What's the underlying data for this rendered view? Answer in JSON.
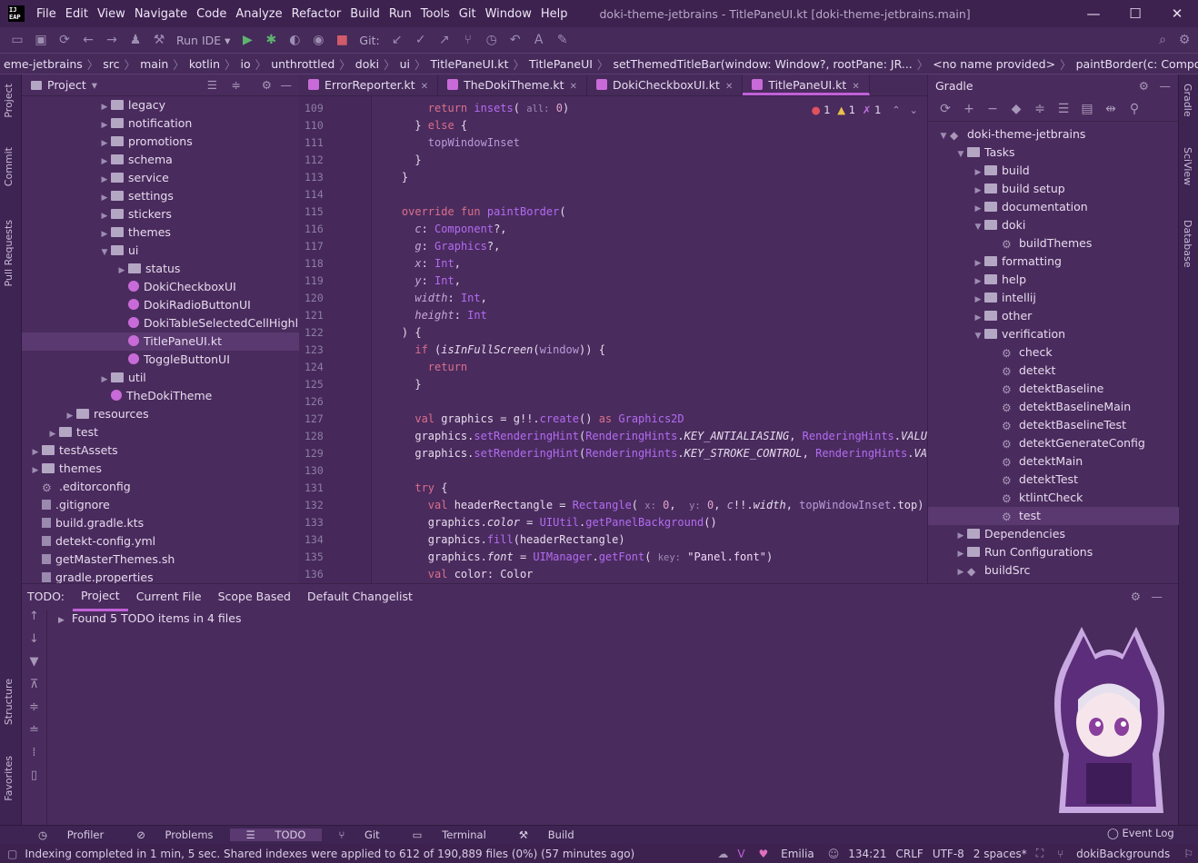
{
  "window": {
    "title": "doki-theme-jetbrains - TitlePaneUI.kt [doki-theme-jetbrains.main]",
    "logo": "IJ\nEAP",
    "minimize": "—",
    "maximize": "☐",
    "close": "✕"
  },
  "menu": [
    "File",
    "Edit",
    "View",
    "Navigate",
    "Code",
    "Analyze",
    "Refactor",
    "Build",
    "Run",
    "Tools",
    "Git",
    "Window",
    "Help"
  ],
  "toolbar": {
    "run_config": "Run IDE",
    "git_label": "Git:"
  },
  "breadcrumbs": [
    "eme-jetbrains",
    "src",
    "main",
    "kotlin",
    "io",
    "unthrottled",
    "doki",
    "ui",
    "TitlePaneUI.kt",
    "TitlePaneUI",
    "setThemedTitleBar(window: Window?, rootPane: JR...",
    "<no name provided>",
    "paintBorder(c: Component?, g: Graphics?, x: Int..."
  ],
  "left_strip": [
    "Project",
    "Commit",
    "Pull Requests",
    "Structure",
    "Favorites"
  ],
  "right_strip": [
    "Gradle",
    "SciView",
    "Database"
  ],
  "project_panel": {
    "title": "Project",
    "items": [
      {
        "label": "legacy",
        "depth": 4,
        "type": "folder",
        "arrow": "▶"
      },
      {
        "label": "notification",
        "depth": 4,
        "type": "folder",
        "arrow": "▶"
      },
      {
        "label": "promotions",
        "depth": 4,
        "type": "folder",
        "arrow": "▶"
      },
      {
        "label": "schema",
        "depth": 4,
        "type": "folder",
        "arrow": "▶"
      },
      {
        "label": "service",
        "depth": 4,
        "type": "folder",
        "arrow": "▶"
      },
      {
        "label": "settings",
        "depth": 4,
        "type": "folder",
        "arrow": "▶"
      },
      {
        "label": "stickers",
        "depth": 4,
        "type": "folder",
        "arrow": "▶"
      },
      {
        "label": "themes",
        "depth": 4,
        "type": "folder",
        "arrow": "▶"
      },
      {
        "label": "ui",
        "depth": 4,
        "type": "folder",
        "arrow": "▼"
      },
      {
        "label": "status",
        "depth": 5,
        "type": "folder",
        "arrow": "▶"
      },
      {
        "label": "DokiCheckboxUI",
        "depth": 5,
        "type": "kt",
        "arrow": ""
      },
      {
        "label": "DokiRadioButtonUI",
        "depth": 5,
        "type": "kt",
        "arrow": ""
      },
      {
        "label": "DokiTableSelectedCellHighlightB",
        "depth": 5,
        "type": "kt",
        "arrow": ""
      },
      {
        "label": "TitlePaneUI.kt",
        "depth": 5,
        "type": "kt",
        "arrow": "",
        "selected": true
      },
      {
        "label": "ToggleButtonUI",
        "depth": 5,
        "type": "kt",
        "arrow": ""
      },
      {
        "label": "util",
        "depth": 4,
        "type": "folder",
        "arrow": "▶"
      },
      {
        "label": "TheDokiTheme",
        "depth": 4,
        "type": "kt",
        "arrow": ""
      },
      {
        "label": "resources",
        "depth": 2,
        "type": "folder",
        "arrow": "▶"
      },
      {
        "label": "test",
        "depth": 1,
        "type": "folder",
        "arrow": "▶"
      },
      {
        "label": "testAssets",
        "depth": 0,
        "type": "folder",
        "arrow": "▶"
      },
      {
        "label": "themes",
        "depth": 0,
        "type": "folder",
        "arrow": "▶"
      },
      {
        "label": ".editorconfig",
        "depth": 0,
        "type": "gear",
        "arrow": ""
      },
      {
        "label": ".gitignore",
        "depth": 0,
        "type": "file",
        "arrow": ""
      },
      {
        "label": "build.gradle.kts",
        "depth": 0,
        "type": "file",
        "arrow": ""
      },
      {
        "label": "detekt-config.yml",
        "depth": 0,
        "type": "file",
        "arrow": ""
      },
      {
        "label": "getMasterThemes.sh",
        "depth": 0,
        "type": "file",
        "arrow": ""
      },
      {
        "label": "gradle.properties",
        "depth": 0,
        "type": "file",
        "arrow": ""
      }
    ]
  },
  "tabs": [
    {
      "label": "ErrorReporter.kt"
    },
    {
      "label": "TheDokiTheme.kt"
    },
    {
      "label": "DokiCheckboxUI.kt"
    },
    {
      "label": "TitlePaneUI.kt",
      "active": true
    }
  ],
  "inspections": {
    "errors": "1",
    "warnings": "1",
    "typos": "1"
  },
  "code_lines": [
    {
      "n": "109",
      "html": "        <span class='kw'>return</span> <span class='fn'>insets</span>( <span class='hint'>all:</span> <span class='nm'>0</span>)"
    },
    {
      "n": "110",
      "html": "      } <span class='kw'>else</span> {"
    },
    {
      "n": "111",
      "html": "        <span class='pl'>topWindowInset</span>"
    },
    {
      "n": "112",
      "html": "      }"
    },
    {
      "n": "113",
      "html": "    }"
    },
    {
      "n": "114",
      "html": ""
    },
    {
      "n": "115",
      "html": "    <span class='kw'>override fun</span> <span class='fn'>paintBorder</span>("
    },
    {
      "n": "116",
      "html": "      <span class='pm'>c</span>: <span class='ty'>Component</span>?,"
    },
    {
      "n": "117",
      "html": "      <span class='pm'>g</span>: <span class='ty'>Graphics</span>?,"
    },
    {
      "n": "118",
      "html": "      <span class='pm'>x</span>: <span class='ty'>Int</span>,"
    },
    {
      "n": "119",
      "html": "      <span class='pm'>y</span>: <span class='ty'>Int</span>,"
    },
    {
      "n": "120",
      "html": "      <span class='pm'>width</span>: <span class='ty'>Int</span>,"
    },
    {
      "n": "121",
      "html": "      <span class='pm'>height</span>: <span class='ty'>Int</span>"
    },
    {
      "n": "122",
      "html": "    ) {"
    },
    {
      "n": "123",
      "html": "      <span class='kw'>if</span> (<span class='it'>isInFullScreen</span>(<span class='pl'>window</span>)) {"
    },
    {
      "n": "124",
      "html": "        <span class='kw'>return</span>"
    },
    {
      "n": "125",
      "html": "      }"
    },
    {
      "n": "126",
      "html": ""
    },
    {
      "n": "127",
      "html": "      <span class='kw'>val</span> graphics = g!!.<span class='fn'>create</span>() <span class='kw'>as</span> <span class='ty'>Graphics2D</span>"
    },
    {
      "n": "128",
      "html": "      graphics.<span class='fn'>setRenderingHint</span>(<span class='ty'>RenderingHints</span>.<span class='it'>KEY_ANTIALIASING</span>, <span class='ty'>RenderingHints</span>.<span class='it'>VALUE_A</span>"
    },
    {
      "n": "129",
      "html": "      graphics.<span class='fn'>setRenderingHint</span>(<span class='ty'>RenderingHints</span>.<span class='it'>KEY_STROKE_CONTROL</span>, <span class='ty'>RenderingHints</span>.<span class='it'>VALUE</span>"
    },
    {
      "n": "130",
      "html": ""
    },
    {
      "n": "131",
      "html": "      <span class='kw'>try</span> {"
    },
    {
      "n": "132",
      "html": "        <span class='kw'>val</span> headerRectangle = <span class='fn'>Rectangle</span>( <span class='hint'>x:</span> <span class='nm'>0</span>,  <span class='hint'>y:</span> <span class='nm'>0</span>, <span class='pm'>c</span>!!.<span class='it'>width</span>, <span class='pl'>topWindowInset</span>.top)"
    },
    {
      "n": "133",
      "html": "        graphics.<span class='it'>color</span> = <span class='ty'>UIUtil</span>.<span class='fn'>getPanelBackground</span>()"
    },
    {
      "n": "134",
      "html": "        graphics.<span class='fn'>fill</span>(headerRectangle)"
    },
    {
      "n": "135",
      "html": "        graphics.<span class='it'>font</span> = <span class='ty'>UIManager</span>.<span class='fn'>getFont</span>( <span class='hint'>key:</span> <span class='str'>\"Panel.font\"</span>)"
    },
    {
      "n": "136",
      "html": "        <span class='kw'>val</span> color: Color"
    }
  ],
  "gradle_panel": {
    "title": "Gradle",
    "items": [
      {
        "label": "doki-theme-jetbrains",
        "depth": 0,
        "arrow": "▼",
        "type": "elephant"
      },
      {
        "label": "Tasks",
        "depth": 1,
        "arrow": "▼",
        "type": "folder"
      },
      {
        "label": "build",
        "depth": 2,
        "arrow": "▶",
        "type": "folder"
      },
      {
        "label": "build setup",
        "depth": 2,
        "arrow": "▶",
        "type": "folder"
      },
      {
        "label": "documentation",
        "depth": 2,
        "arrow": "▶",
        "type": "folder"
      },
      {
        "label": "doki",
        "depth": 2,
        "arrow": "▼",
        "type": "folder"
      },
      {
        "label": "buildThemes",
        "depth": 3,
        "arrow": "",
        "type": "gear"
      },
      {
        "label": "formatting",
        "depth": 2,
        "arrow": "▶",
        "type": "folder"
      },
      {
        "label": "help",
        "depth": 2,
        "arrow": "▶",
        "type": "folder"
      },
      {
        "label": "intellij",
        "depth": 2,
        "arrow": "▶",
        "type": "folder"
      },
      {
        "label": "other",
        "depth": 2,
        "arrow": "▶",
        "type": "folder"
      },
      {
        "label": "verification",
        "depth": 2,
        "arrow": "▼",
        "type": "folder"
      },
      {
        "label": "check",
        "depth": 3,
        "arrow": "",
        "type": "gear"
      },
      {
        "label": "detekt",
        "depth": 3,
        "arrow": "",
        "type": "gear"
      },
      {
        "label": "detektBaseline",
        "depth": 3,
        "arrow": "",
        "type": "gear"
      },
      {
        "label": "detektBaselineMain",
        "depth": 3,
        "arrow": "",
        "type": "gear"
      },
      {
        "label": "detektBaselineTest",
        "depth": 3,
        "arrow": "",
        "type": "gear"
      },
      {
        "label": "detektGenerateConfig",
        "depth": 3,
        "arrow": "",
        "type": "gear"
      },
      {
        "label": "detektMain",
        "depth": 3,
        "arrow": "",
        "type": "gear"
      },
      {
        "label": "detektTest",
        "depth": 3,
        "arrow": "",
        "type": "gear"
      },
      {
        "label": "ktlintCheck",
        "depth": 3,
        "arrow": "",
        "type": "gear"
      },
      {
        "label": "test",
        "depth": 3,
        "arrow": "",
        "type": "gear",
        "selected": true
      },
      {
        "label": "Dependencies",
        "depth": 1,
        "arrow": "▶",
        "type": "folder"
      },
      {
        "label": "Run Configurations",
        "depth": 1,
        "arrow": "▶",
        "type": "folder"
      },
      {
        "label": "buildSrc",
        "depth": 1,
        "arrow": "▶",
        "type": "elephant"
      }
    ]
  },
  "todo_panel": {
    "label": "TODO:",
    "tabs": [
      "Project",
      "Current File",
      "Scope Based",
      "Default Changelist"
    ],
    "result": "Found 5 TODO items in 4 files"
  },
  "bottom_tabs": [
    "Profiler",
    "Problems",
    "TODO",
    "Git",
    "Terminal",
    "Build"
  ],
  "event_log": "Event Log",
  "status": {
    "message": "Indexing completed in 1 min, 5 sec. Shared indexes were applied to 612 of 190,889 files (0%) (57 minutes ago)",
    "theme": "Emilia",
    "position": "134:21",
    "line_sep": "CRLF",
    "encoding": "UTF-8",
    "indent": "2 spaces*",
    "branch": "dokiBackgrounds"
  },
  "colors": {
    "accent": "#c060d8",
    "background": "#4a2b5e",
    "keyword": "#d9708a",
    "function": "#b26cf0"
  }
}
